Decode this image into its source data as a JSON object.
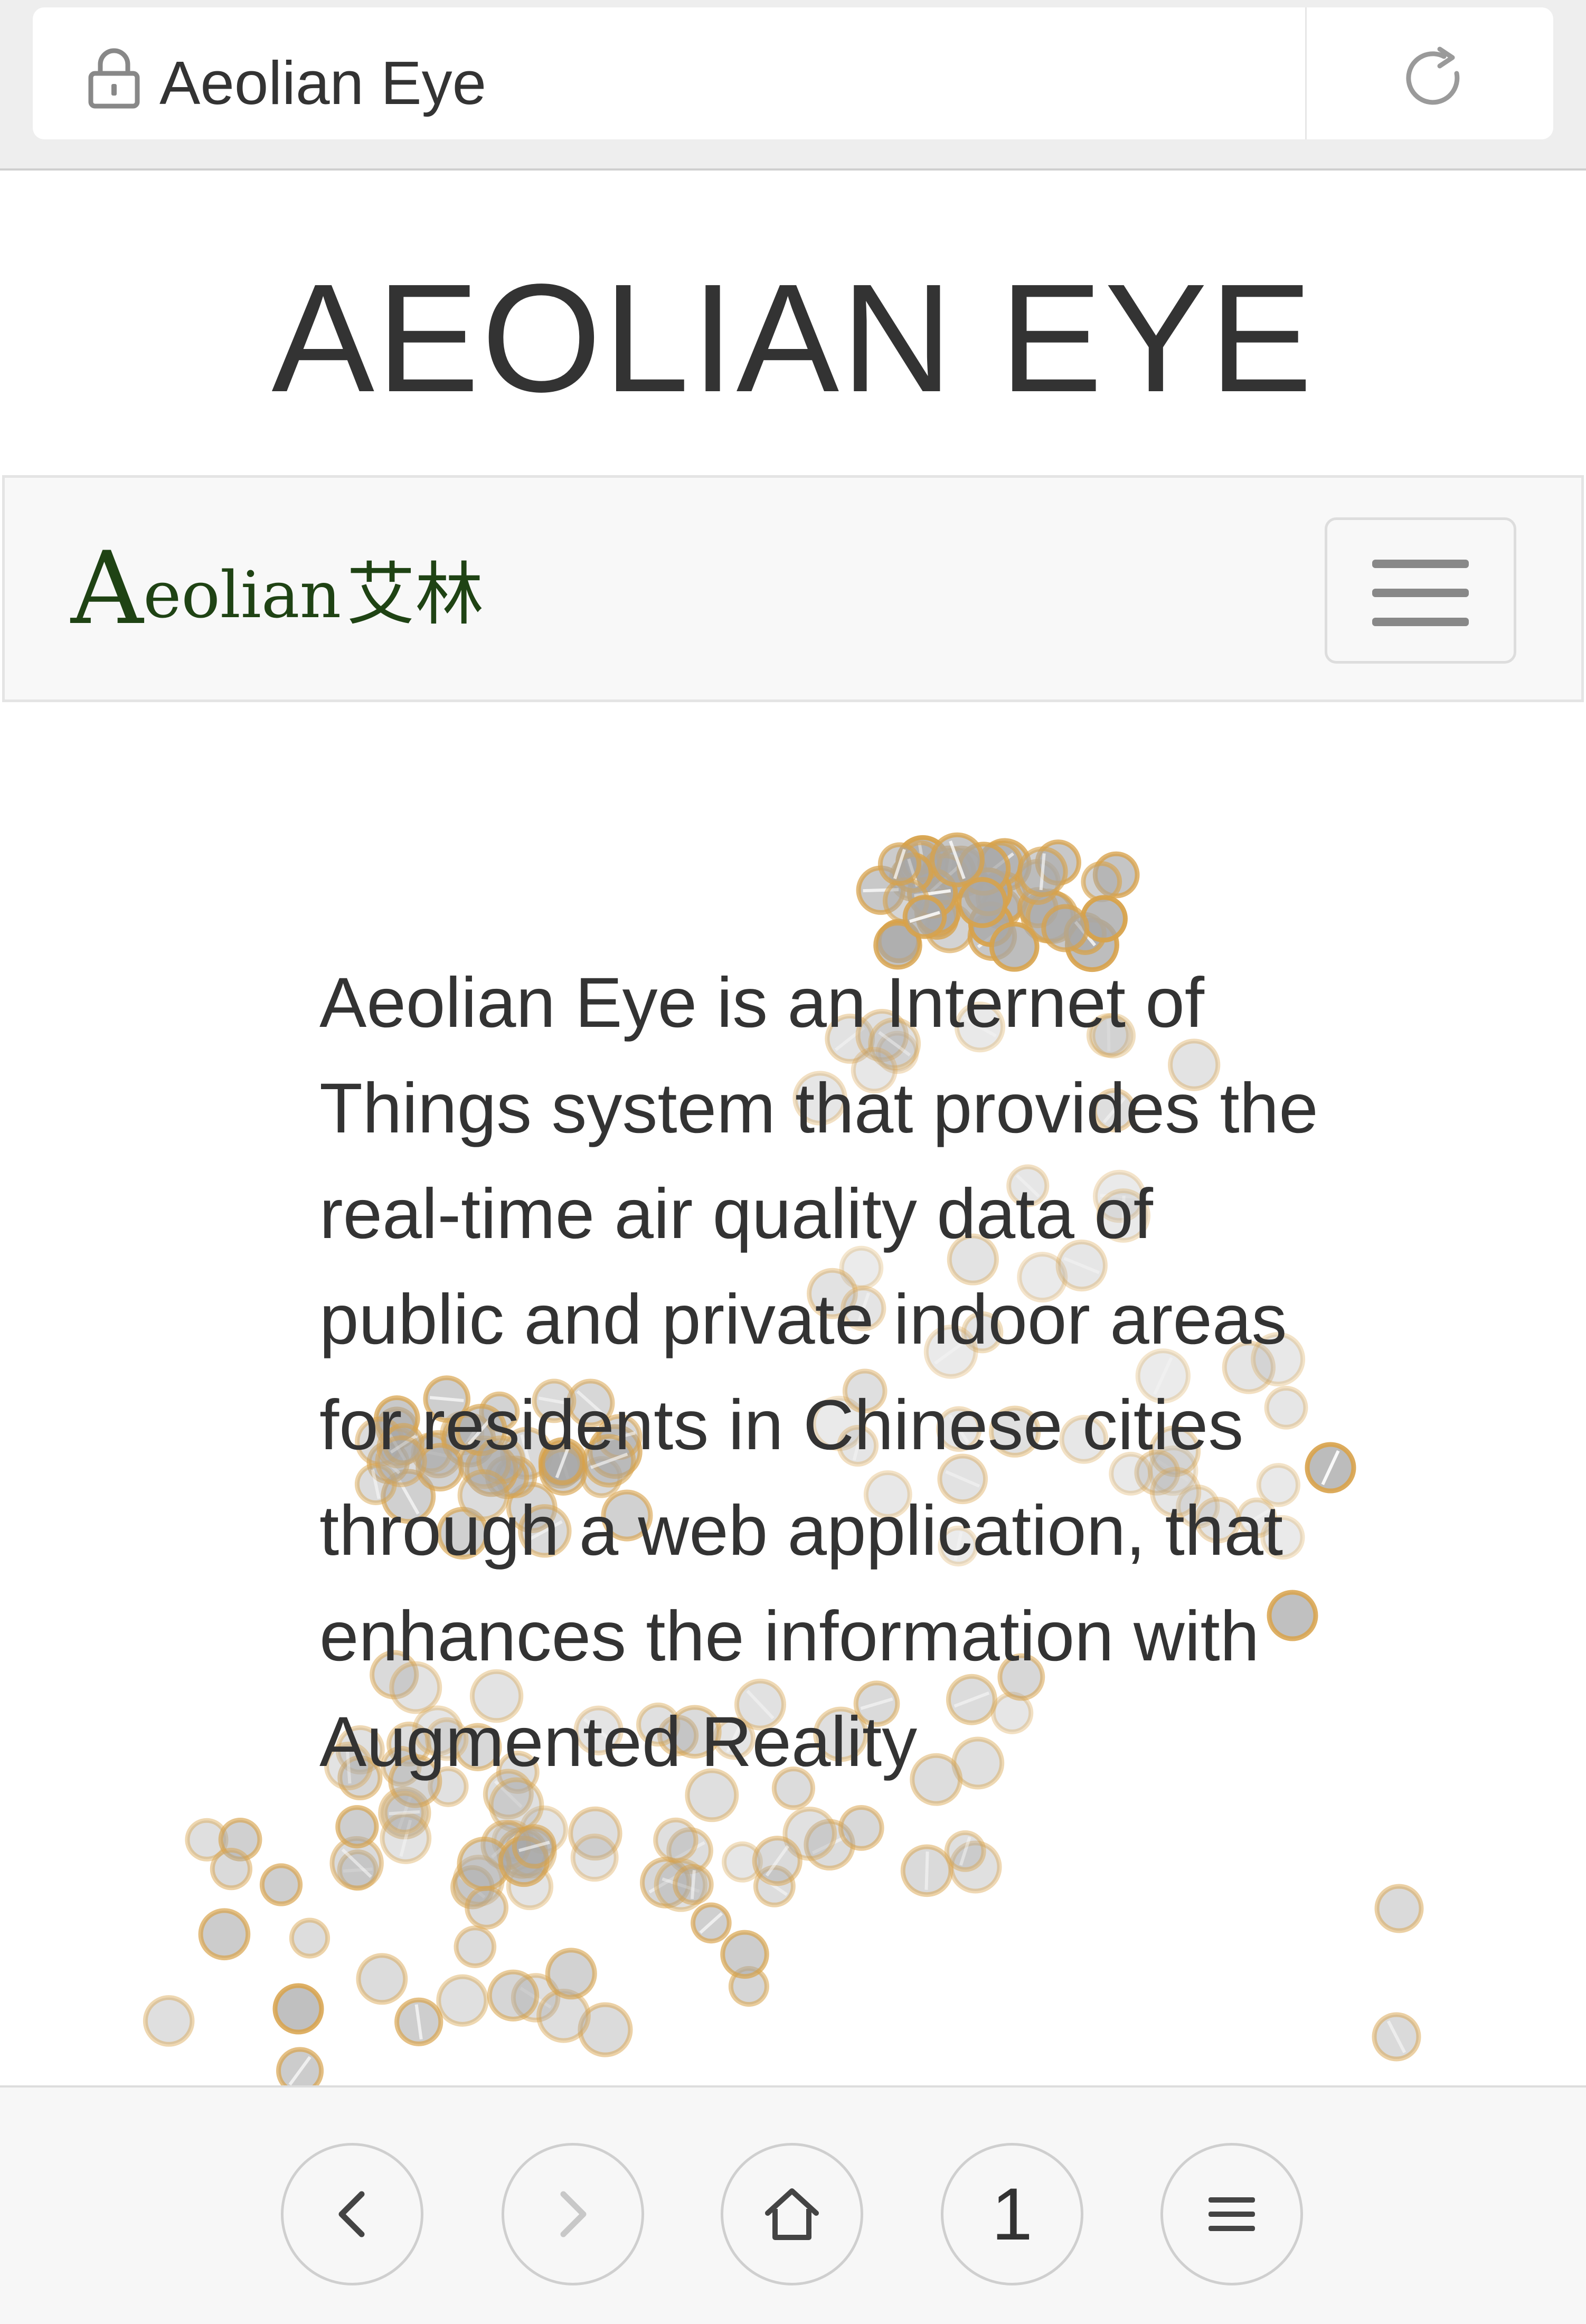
{
  "browser": {
    "page_title": "Aeolian Eye",
    "tab_count": "1",
    "icons": {
      "lock": "lock-icon",
      "reload": "reload-icon",
      "back": "chevron-left-icon",
      "forward": "chevron-right-icon",
      "home": "home-icon",
      "menu": "hamburger-menu-icon"
    }
  },
  "site": {
    "heading": "AEOLIAN EYE",
    "brand_logo_text": "Aeolian艾林",
    "intro": "Aeolian Eye is an Internet of Things system that provides the real-time air quality data of public and private indoor areas for residents in Chinese cities through a web application, that enhances the information with Augmented Reality"
  },
  "colors": {
    "brand_green": "#1f4314",
    "dot_gold": "#d8a24a",
    "dot_gray": "#a8a8a8",
    "text": "#333333"
  }
}
